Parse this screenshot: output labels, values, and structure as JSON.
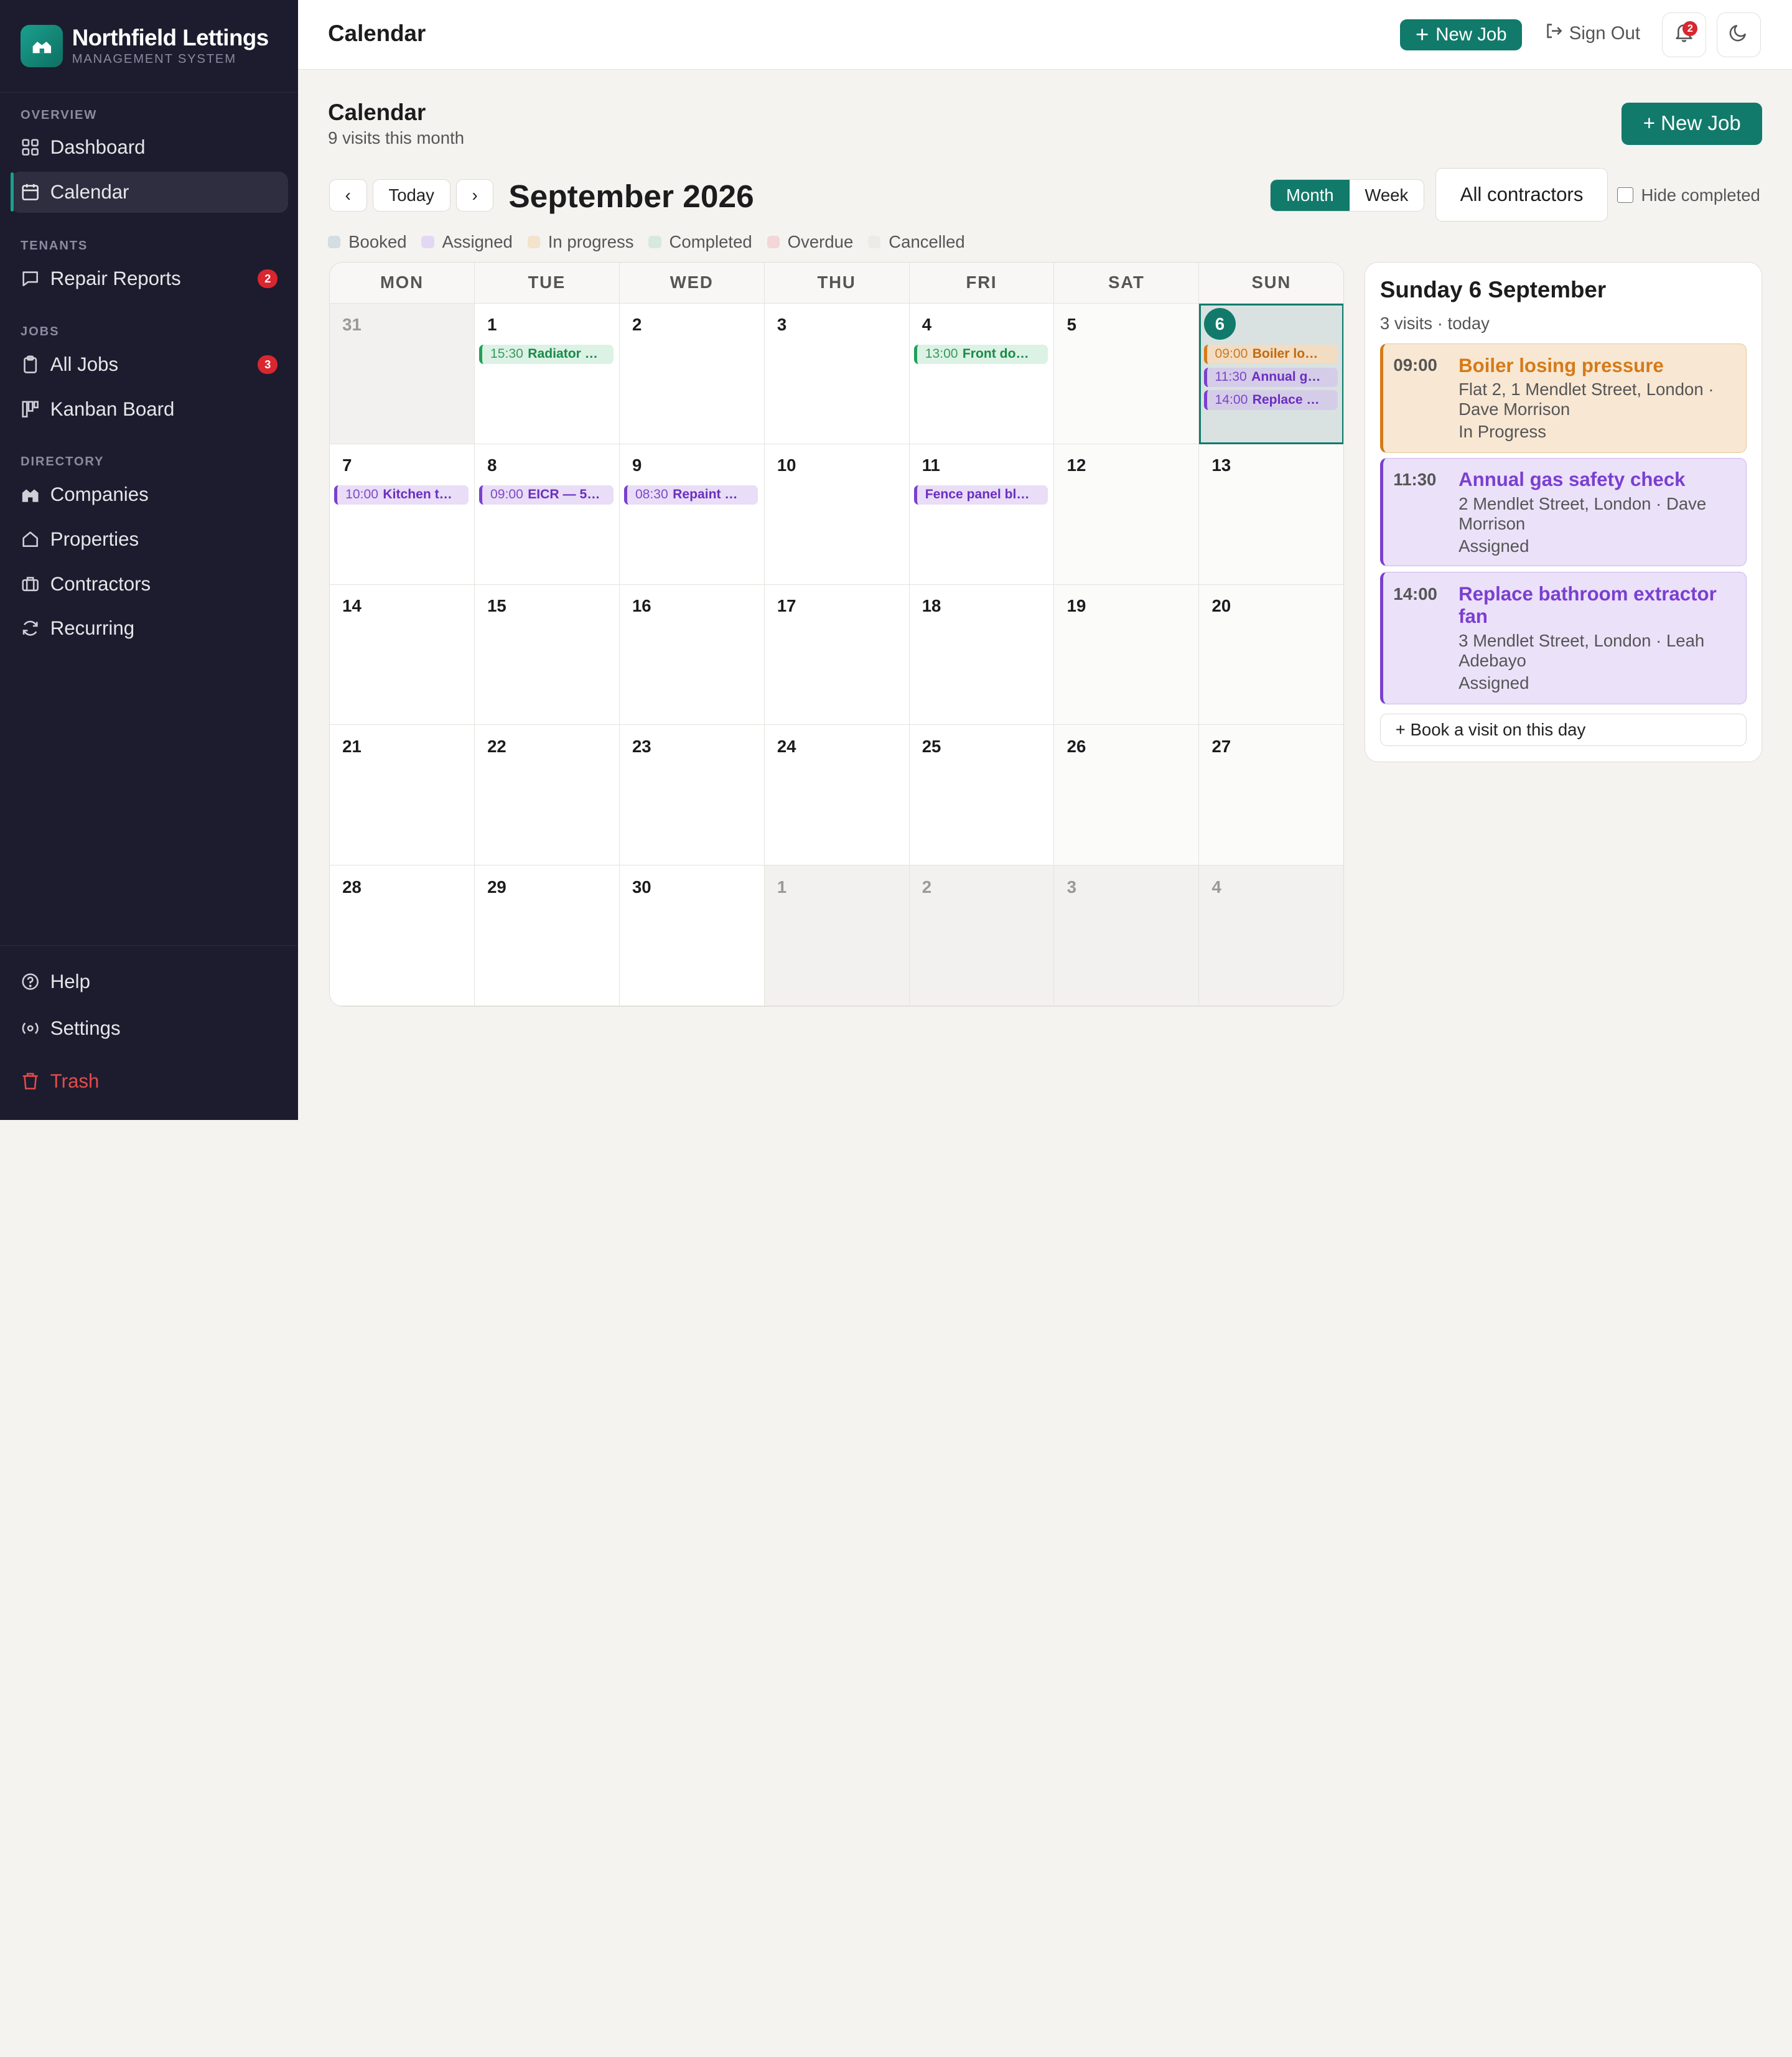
{
  "brand": {
    "name": "Northfield Lettings",
    "subtitle": "MANAGEMENT SYSTEM"
  },
  "sidebar": {
    "sections": {
      "overview": "OVERVIEW",
      "tenants": "TENANTS",
      "jobs": "JOBS",
      "directory": "DIRECTORY"
    },
    "items": {
      "dashboard": "Dashboard",
      "calendar": "Calendar",
      "repair_reports": "Repair Reports",
      "repair_reports_badge": "2",
      "all_jobs": "All Jobs",
      "all_jobs_badge": "3",
      "kanban": "Kanban Board",
      "companies": "Companies",
      "properties": "Properties",
      "contractors": "Contractors",
      "recurring": "Recurring",
      "help": "Help",
      "settings": "Settings",
      "trash": "Trash"
    }
  },
  "topbar": {
    "title": "Calendar",
    "new_job": "New Job",
    "sign_out": "Sign Out",
    "notif_count": "2"
  },
  "page": {
    "title": "Calendar",
    "subtitle": "9 visits this month",
    "new_job": "+ New Job"
  },
  "toolbar": {
    "prev": "‹",
    "today": "Today",
    "next": "›",
    "month_title": "September 2026",
    "view_month": "Month",
    "view_week": "Week",
    "contractors": "All contractors",
    "hide_completed": "Hide completed"
  },
  "legend": [
    {
      "label": "Booked",
      "color": "#d3dde2"
    },
    {
      "label": "Assigned",
      "color": "#e3d8f3"
    },
    {
      "label": "In progress",
      "color": "#f3e2cc"
    },
    {
      "label": "Completed",
      "color": "#d7e9dd"
    },
    {
      "label": "Overdue",
      "color": "#f4d6d6"
    },
    {
      "label": "Cancelled",
      "color": "#ecebe8"
    }
  ],
  "calendar": {
    "weekdays": [
      "MON",
      "TUE",
      "WED",
      "THU",
      "FRI",
      "SAT",
      "SUN"
    ],
    "days": [
      {
        "n": "31",
        "out": true
      },
      {
        "n": "1",
        "events": [
          {
            "time": "15:30",
            "name": "Radiator …",
            "color": "green"
          }
        ]
      },
      {
        "n": "2"
      },
      {
        "n": "3"
      },
      {
        "n": "4",
        "events": [
          {
            "time": "13:00",
            "name": "Front do…",
            "color": "green"
          }
        ]
      },
      {
        "n": "5",
        "weekend": true
      },
      {
        "n": "6",
        "weekend": true,
        "selected": true,
        "today": true,
        "events": [
          {
            "time": "09:00",
            "name": "Boiler lo…",
            "color": "orange"
          },
          {
            "time": "11:30",
            "name": "Annual g…",
            "color": "purple2"
          },
          {
            "time": "14:00",
            "name": "Replace …",
            "color": "purple2"
          }
        ]
      },
      {
        "n": "7",
        "events": [
          {
            "time": "10:00",
            "name": "Kitchen t…",
            "color": "purple"
          }
        ]
      },
      {
        "n": "8",
        "events": [
          {
            "time": "09:00",
            "name": "EICR — 5…",
            "color": "purple"
          }
        ]
      },
      {
        "n": "9",
        "events": [
          {
            "time": "08:30",
            "name": "Repaint …",
            "color": "purple"
          }
        ]
      },
      {
        "n": "10"
      },
      {
        "n": "11",
        "events": [
          {
            "time": "",
            "name": "Fence panel bl…",
            "color": "purple"
          }
        ]
      },
      {
        "n": "12",
        "weekend": true
      },
      {
        "n": "13",
        "weekend": true
      },
      {
        "n": "14"
      },
      {
        "n": "15"
      },
      {
        "n": "16"
      },
      {
        "n": "17"
      },
      {
        "n": "18"
      },
      {
        "n": "19",
        "weekend": true
      },
      {
        "n": "20",
        "weekend": true
      },
      {
        "n": "21"
      },
      {
        "n": "22"
      },
      {
        "n": "23"
      },
      {
        "n": "24"
      },
      {
        "n": "25"
      },
      {
        "n": "26",
        "weekend": true
      },
      {
        "n": "27",
        "weekend": true
      },
      {
        "n": "28"
      },
      {
        "n": "29"
      },
      {
        "n": "30"
      },
      {
        "n": "1",
        "out": true
      },
      {
        "n": "2",
        "out": true
      },
      {
        "n": "3",
        "out": true
      },
      {
        "n": "4",
        "out": true
      }
    ]
  },
  "panel": {
    "title": "Sunday 6 September",
    "subtitle": "3 visits · today",
    "visits": [
      {
        "time": "09:00",
        "name": "Boiler losing pressure",
        "address": "Flat 2, 1 Mendlet Street, London · Dave Morrison",
        "status": "In Progress"
      },
      {
        "time": "11:30",
        "name": "Annual gas safety check",
        "address": "2 Mendlet Street, London · Dave Morrison",
        "status": "Assigned"
      },
      {
        "time": "14:00",
        "name": "Replace bathroom extractor fan",
        "address": "3 Mendlet Street, London · Leah Adebayo",
        "status": "Assigned"
      }
    ],
    "book": "+ Book a visit on this day"
  }
}
